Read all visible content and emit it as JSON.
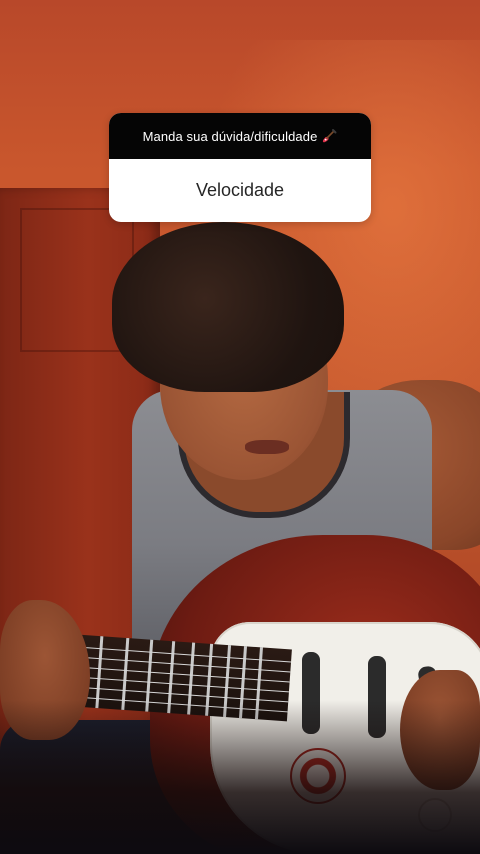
{
  "question_sticker": {
    "prompt": "Manda sua dúvida/dificuldade",
    "prompt_icon": "guitar-icon",
    "answer": "Velocidade",
    "header_color": "#050505",
    "card_color": "#ffffff"
  },
  "scene": {
    "description_icon": "video-background",
    "wall_color": "#c9572d"
  }
}
